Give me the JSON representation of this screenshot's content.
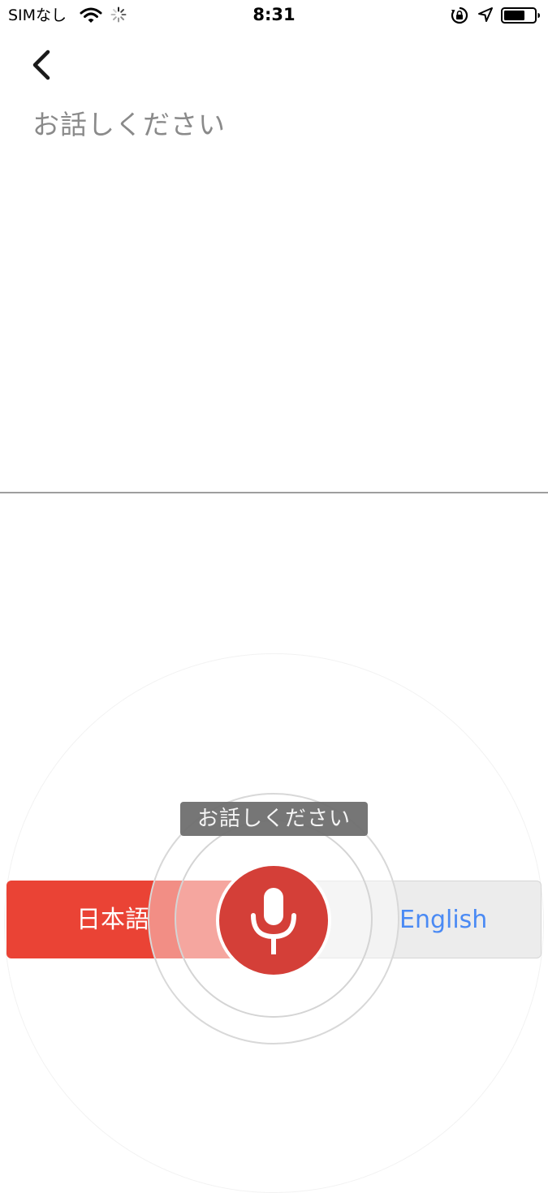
{
  "status_bar": {
    "carrier": "SIMなし",
    "time": "8:31",
    "icons": [
      "wifi-icon",
      "loading-spinner-icon",
      "rotation-lock-icon",
      "location-arrow-icon",
      "battery-icon"
    ]
  },
  "header": {
    "back_icon": "chevron-left-icon",
    "prompt": "お話しください"
  },
  "tooltip": {
    "text": "お話しください"
  },
  "language_bar": {
    "source_language": "日本語",
    "target_language": "English",
    "mic_icon": "microphone-icon"
  },
  "colors": {
    "source_button": "#ea4335",
    "mic_button": "#d43f38",
    "target_text": "#4a8af4",
    "target_button": "#ececec",
    "prompt_text": "#8a8a8a"
  }
}
